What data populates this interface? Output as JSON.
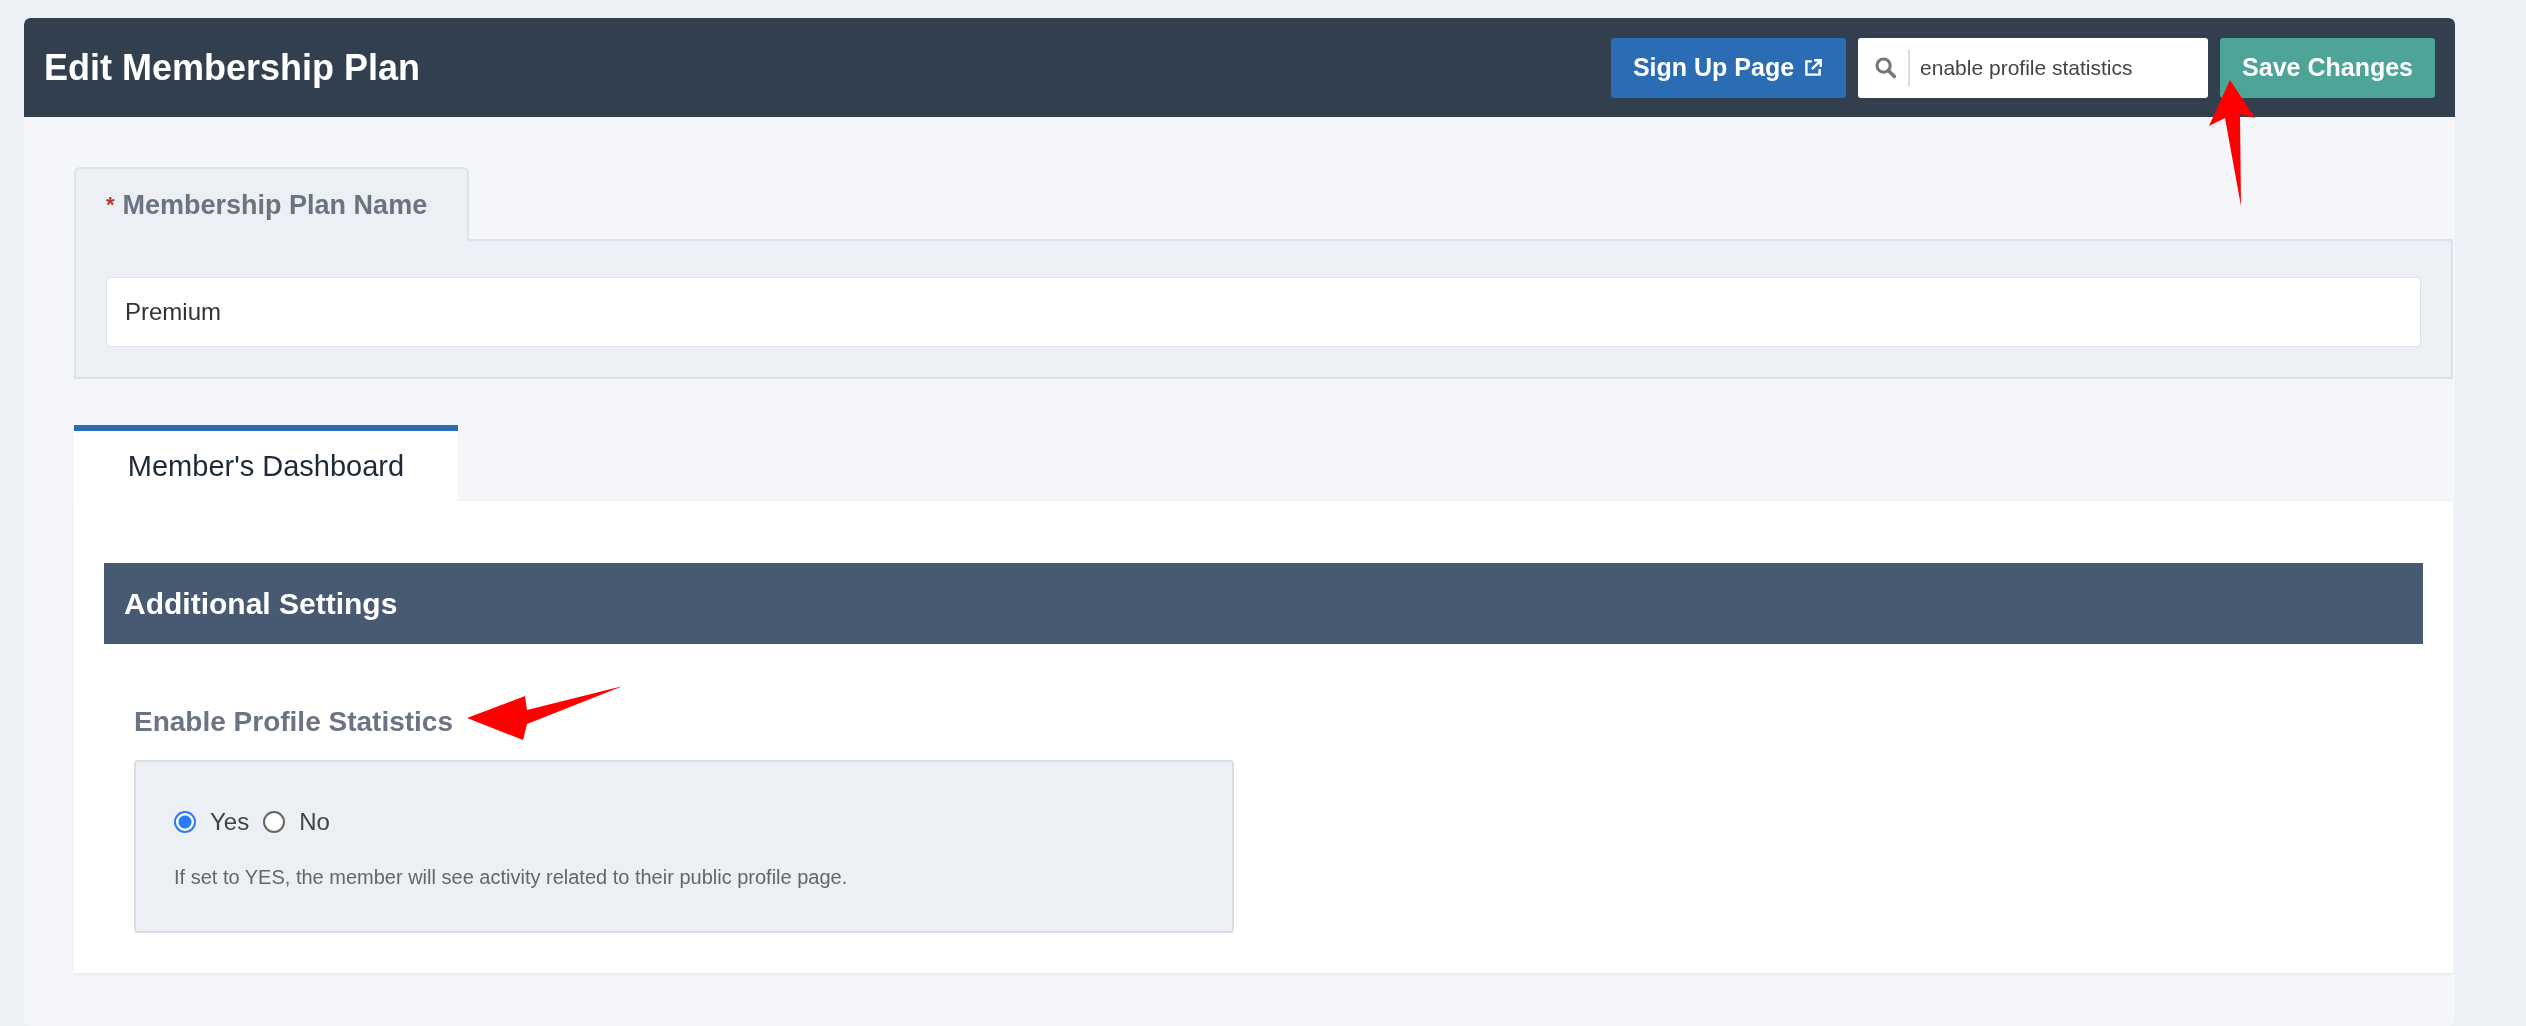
{
  "header": {
    "title": "Edit Membership Plan",
    "signup_button": "Sign Up Page",
    "search": {
      "value": "enable profile statistics"
    },
    "save_button": "Save Changes"
  },
  "plan_name": {
    "label": "Membership Plan Name",
    "required_mark": "*",
    "value": "Premium"
  },
  "tabs": [
    {
      "label": "Member's Dashboard",
      "selected": true
    }
  ],
  "section": {
    "title": "Additional Settings"
  },
  "setting": {
    "label": "Enable Profile Statistics",
    "options": [
      {
        "label": "Yes",
        "selected": true
      },
      {
        "label": "No",
        "selected": false
      }
    ],
    "help": "If set to YES, the member will see activity related to their public profile page."
  }
}
